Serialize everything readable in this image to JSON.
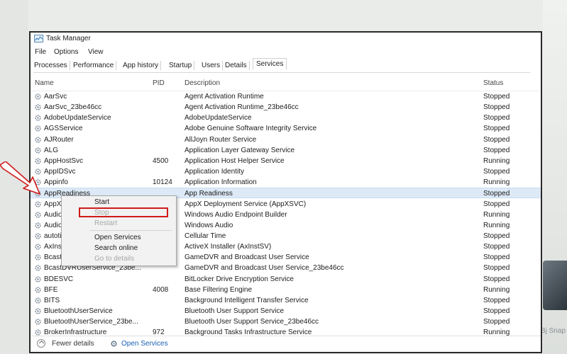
{
  "window": {
    "title": "Task Manager"
  },
  "menu": [
    "File",
    "Options",
    "View"
  ],
  "tabs": [
    "Processes",
    "Performance",
    "App history",
    "Startup",
    "Users",
    "Details",
    "Services"
  ],
  "active_tab": "Services",
  "columns": {
    "name": "Name",
    "pid": "PID",
    "description": "Description",
    "status": "Status"
  },
  "rows": [
    {
      "name": "AarSvc",
      "pid": "",
      "description": "Agent Activation Runtime",
      "status": "Stopped"
    },
    {
      "name": "AarSvc_23be46cc",
      "pid": "",
      "description": "Agent Activation Runtime_23be46cc",
      "status": "Stopped"
    },
    {
      "name": "AdobeUpdateService",
      "pid": "",
      "description": "AdobeUpdateService",
      "status": "Stopped"
    },
    {
      "name": "AGSService",
      "pid": "",
      "description": "Adobe Genuine Software Integrity Service",
      "status": "Stopped"
    },
    {
      "name": "AJRouter",
      "pid": "",
      "description": "AllJoyn Router Service",
      "status": "Stopped"
    },
    {
      "name": "ALG",
      "pid": "",
      "description": "Application Layer Gateway Service",
      "status": "Stopped"
    },
    {
      "name": "AppHostSvc",
      "pid": "4500",
      "description": "Application Host Helper Service",
      "status": "Running"
    },
    {
      "name": "AppIDSvc",
      "pid": "",
      "description": "Application Identity",
      "status": "Stopped"
    },
    {
      "name": "Appinfo",
      "pid": "10124",
      "description": "Application Information",
      "status": "Running"
    },
    {
      "name": "AppReadiness",
      "pid": "",
      "description": "App Readiness",
      "status": "Stopped"
    },
    {
      "name": "AppXSvc",
      "pid": "",
      "description": "AppX Deployment Service (AppXSVC)",
      "status": "Stopped"
    },
    {
      "name": "AudioEnd",
      "pid": "",
      "description": "Windows Audio Endpoint Builder",
      "status": "Running"
    },
    {
      "name": "Audiosrv",
      "pid": "",
      "description": "Windows Audio",
      "status": "Running"
    },
    {
      "name": "autotime",
      "pid": "",
      "description": "Cellular Time",
      "status": "Stopped"
    },
    {
      "name": "AxInstSV",
      "pid": "",
      "description": "ActiveX Installer (AxInstSV)",
      "status": "Stopped"
    },
    {
      "name": "BcastDVR",
      "pid": "",
      "description": "GameDVR and Broadcast User Service",
      "status": "Stopped"
    },
    {
      "name": "BcastDVRUserService_23be...",
      "pid": "",
      "description": "GameDVR and Broadcast User Service_23be46cc",
      "status": "Stopped"
    },
    {
      "name": "BDESVC",
      "pid": "",
      "description": "BitLocker Drive Encryption Service",
      "status": "Stopped"
    },
    {
      "name": "BFE",
      "pid": "4008",
      "description": "Base Filtering Engine",
      "status": "Running"
    },
    {
      "name": "BITS",
      "pid": "",
      "description": "Background Intelligent Transfer Service",
      "status": "Stopped"
    },
    {
      "name": "BluetoothUserService",
      "pid": "",
      "description": "Bluetooth User Support Service",
      "status": "Stopped"
    },
    {
      "name": "BluetoothUserService_23be...",
      "pid": "",
      "description": "Bluetooth User Support Service_23be46cc",
      "status": "Stopped"
    },
    {
      "name": "BrokerInfrastructure",
      "pid": "972",
      "description": "Background Tasks Infrastructure Service",
      "status": "Running"
    }
  ],
  "selected_row": "AppReadiness",
  "context_menu": {
    "start": "Start",
    "stop": "Stop",
    "restart": "Restart",
    "open_services": "Open Services",
    "search_online": "Search online",
    "go_to_details": "Go to details"
  },
  "footer": {
    "fewer_details": "Fewer details",
    "open_services": "Open Services"
  },
  "watermark": "Bj Snap",
  "colors": {
    "selection": "#dde9f6",
    "highlight_box": "#d11a1a",
    "link": "#1a5fb4",
    "arrow": "#d11a1a"
  }
}
